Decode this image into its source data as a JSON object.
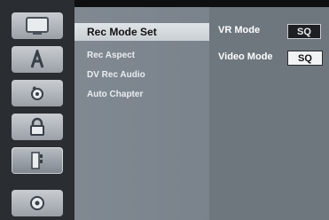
{
  "rail": {
    "items": [
      {
        "icon": "tv-icon"
      },
      {
        "icon": "language-a-icon"
      },
      {
        "icon": "audio-disc-icon"
      },
      {
        "icon": "lock-icon"
      },
      {
        "icon": "record-icon"
      },
      {
        "icon": "disc-icon"
      }
    ]
  },
  "submenu": {
    "items": [
      {
        "label": "Rec Mode Set"
      },
      {
        "label": "Rec Aspect"
      },
      {
        "label": "DV Rec Audio"
      },
      {
        "label": "Auto Chapter"
      }
    ]
  },
  "settings": {
    "vr_mode": {
      "label": "VR Mode",
      "value": "SQ"
    },
    "video_mode": {
      "label": "Video Mode",
      "value": "SQ"
    }
  },
  "colors": {
    "panel_sub": "#808991",
    "panel_right": "#6e767e",
    "selected": "#dfe4e8"
  }
}
